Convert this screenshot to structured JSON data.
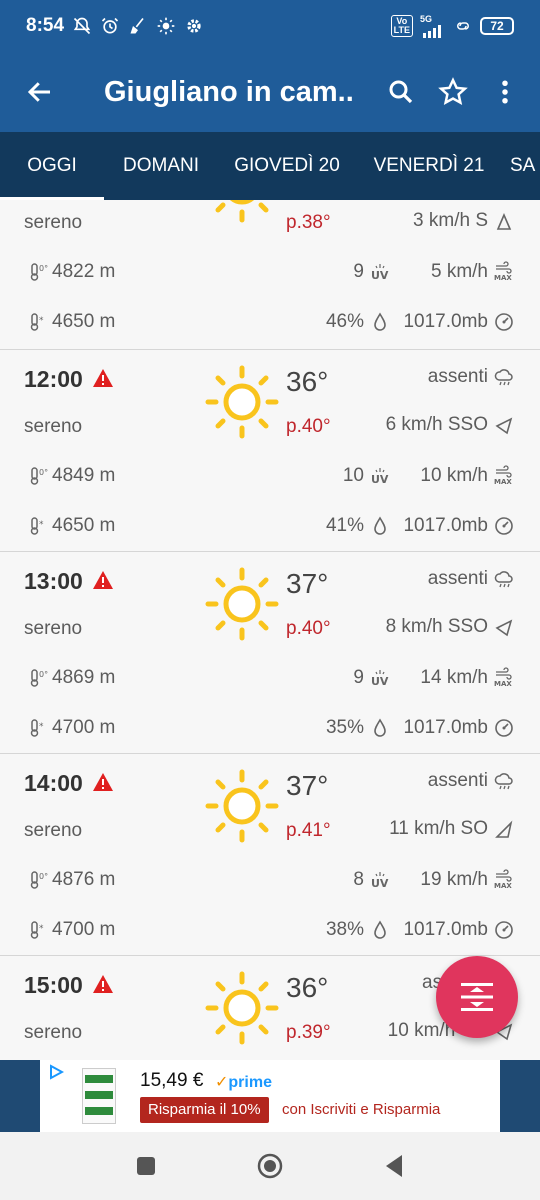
{
  "status_bar": {
    "time": "8:54",
    "net_tag_top": "Vo",
    "net_tag_bottom": "LTE",
    "net_5g": "5G",
    "battery": "72"
  },
  "app_bar": {
    "title": "Giugliano in cam..",
    "icons": [
      "arrow-back-icon",
      "search-icon",
      "star-outline-icon",
      "more-vertical-icon"
    ]
  },
  "tabs": [
    {
      "label": "OGGI",
      "active": true
    },
    {
      "label": "DOMANI"
    },
    {
      "label": "GIOVEDÌ 20"
    },
    {
      "label": "VENERDÌ 21"
    },
    {
      "label": "SA"
    }
  ],
  "colors": {
    "primary": "#1f5c99",
    "tab_bar": "#12395c",
    "perceived_temp": "#c0272d",
    "warning": "#e02020",
    "sun": "#f9c41d",
    "fab": "#e0355d"
  },
  "partial_row": {
    "condition": "sereno",
    "perceived": "p.38°",
    "wind": "3 km/h S",
    "zero_level": "4822 m",
    "uv": "9",
    "gust": "5 km/h",
    "snow_level": "4650 m",
    "humidity": "46%",
    "pressure": "1017.0mb"
  },
  "hours": [
    {
      "hour": "12:00",
      "temp": "36°",
      "precip": "assenti",
      "condition": "sereno",
      "perceived": "p.40°",
      "wind": "6 km/h SSO",
      "zero_level": "4849 m",
      "uv": "10",
      "gust": "10 km/h",
      "snow_level": "4650 m",
      "humidity": "41%",
      "pressure": "1017.0mb"
    },
    {
      "hour": "13:00",
      "temp": "37°",
      "precip": "assenti",
      "condition": "sereno",
      "perceived": "p.40°",
      "wind": "8 km/h SSO",
      "zero_level": "4869 m",
      "uv": "9",
      "gust": "14 km/h",
      "snow_level": "4700 m",
      "humidity": "35%",
      "pressure": "1017.0mb"
    },
    {
      "hour": "14:00",
      "temp": "37°",
      "precip": "assenti",
      "condition": "sereno",
      "perceived": "p.41°",
      "wind": "11 km/h SO",
      "zero_level": "4876 m",
      "uv": "8",
      "gust": "19 km/h",
      "snow_level": "4700 m",
      "humidity": "38%",
      "pressure": "1017.0mb"
    },
    {
      "hour": "15:00",
      "temp": "36°",
      "precip": "as",
      "condition": "sereno",
      "perceived": "p.39°",
      "wind": "10 km/h SO"
    }
  ],
  "ad": {
    "price": "15,49 €",
    "prime": "prime",
    "badge": "Risparmia il 10%",
    "subtext": "con Iscriviti e Risparmia"
  },
  "nav_bar": {
    "icons": [
      "recent-apps-icon",
      "home-icon",
      "back-icon"
    ]
  }
}
